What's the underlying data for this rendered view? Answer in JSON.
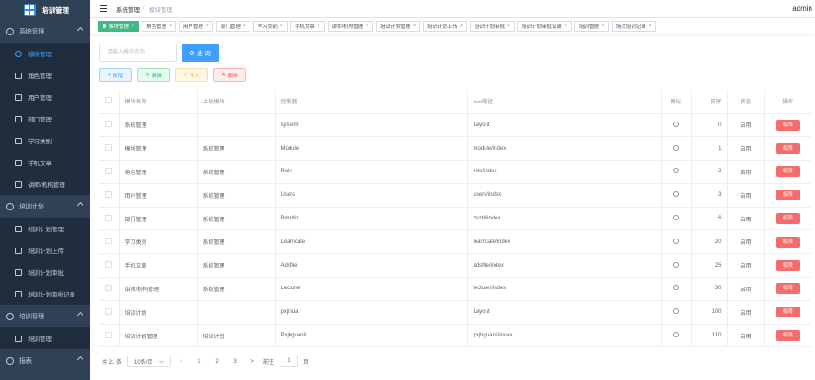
{
  "app": {
    "title": "培训管理"
  },
  "sidebar": {
    "groups": [
      {
        "label": "系统管理",
        "icon": "settings-icon",
        "items": [
          {
            "label": "模块管理",
            "icon": "globe-icon",
            "active": true
          },
          {
            "label": "角色管理",
            "icon": "user-icon"
          },
          {
            "label": "用户管理",
            "icon": "lightbulb-icon"
          },
          {
            "label": "部门管理",
            "icon": "target-icon"
          },
          {
            "label": "学习类别",
            "icon": "document-icon"
          },
          {
            "label": "手机文章",
            "icon": "copy-icon"
          },
          {
            "label": "讲师/机构管理",
            "icon": "briefcase-icon"
          }
        ]
      },
      {
        "label": "培训计划",
        "icon": "clock-icon",
        "items": [
          {
            "label": "培训计划管理",
            "icon": "monitor-icon"
          },
          {
            "label": "培训计划上传",
            "icon": "mail-icon"
          },
          {
            "label": "培训计划审批",
            "icon": "edit-icon"
          },
          {
            "label": "培训计划审批记录",
            "icon": "clipboard-icon"
          }
        ]
      },
      {
        "label": "培训管理",
        "icon": "book-icon",
        "items": [
          {
            "label": "培训管理",
            "icon": "bag-icon"
          }
        ]
      },
      {
        "label": "报表",
        "icon": "chart-icon",
        "items": []
      }
    ]
  },
  "header": {
    "breadcrumb": [
      "系统管理",
      "模块管理"
    ],
    "user": "admin"
  },
  "tags": [
    "模块管理",
    "角色管理",
    "用户管理",
    "部门管理",
    "学习类别",
    "手机文章",
    "讲师/机构管理",
    "培训计划管理",
    "培训计划上传",
    "培训计划审批",
    "培训计划审批记录",
    "培训管理",
    "场次培训记录"
  ],
  "search": {
    "placeholder": "请输入模块名称",
    "button": "查 询"
  },
  "actions": {
    "add": "新增",
    "edit": "编辑",
    "import": "导入",
    "delete": "删除"
  },
  "table": {
    "columns": [
      "模块名称",
      "上级模块",
      "控制器",
      "vue路径",
      "图标",
      "排序",
      "状态",
      "操作"
    ],
    "rows": [
      {
        "name": "系统管理",
        "parent": "",
        "controller": "system",
        "path": "Layout",
        "icon": "settings-icon",
        "sort": "0",
        "status": "启用",
        "op": "权限"
      },
      {
        "name": "模块管理",
        "parent": "系统管理",
        "controller": "Module",
        "path": "module/index",
        "icon": "globe-icon",
        "sort": "1",
        "status": "启用",
        "op": "权限"
      },
      {
        "name": "角色管理",
        "parent": "系统管理",
        "controller": "Role",
        "path": "role/index",
        "icon": "user-icon",
        "sort": "2",
        "status": "启用",
        "op": "权限"
      },
      {
        "name": "用户管理",
        "parent": "系统管理",
        "controller": "Users",
        "path": "users/index",
        "icon": "lightbulb-icon",
        "sort": "3",
        "status": "启用",
        "op": "权限"
      },
      {
        "name": "部门管理",
        "parent": "系统管理",
        "controller": "Bminfo",
        "path": "zuzhi/index",
        "icon": "target-icon",
        "sort": "6",
        "status": "启用",
        "op": "权限"
      },
      {
        "name": "学习类别",
        "parent": "系统管理",
        "controller": "Learncate",
        "path": "learncate/index",
        "icon": "document-icon",
        "sort": "20",
        "status": "启用",
        "op": "权限"
      },
      {
        "name": "手机文章",
        "parent": "系统管理",
        "controller": "Adsfile",
        "path": "adsfile/index",
        "icon": "copy-icon",
        "sort": "25",
        "status": "启用",
        "op": "权限"
      },
      {
        "name": "讲师/机构管理",
        "parent": "系统管理",
        "controller": "Lecturer",
        "path": "lecturer/index",
        "icon": "briefcase-icon",
        "sort": "30",
        "status": "启用",
        "op": "权限"
      },
      {
        "name": "培训计划",
        "parent": "",
        "controller": "pxjihua",
        "path": "Layout",
        "icon": "clock-icon",
        "sort": "100",
        "status": "启用",
        "op": "权限"
      },
      {
        "name": "培训计划管理",
        "parent": "培训计划",
        "controller": "Pxjhguanli",
        "path": "pxjhguanli/index",
        "icon": "monitor-icon",
        "sort": "110",
        "status": "启用",
        "op": "权限"
      }
    ]
  },
  "pager": {
    "total": "共 21 条",
    "size": "10条/页",
    "prev": "<",
    "pages": [
      "1",
      "2",
      "3"
    ],
    "current": "1",
    "next": ">",
    "goto": "前往",
    "page_input": "1",
    "page_unit": "页"
  }
}
